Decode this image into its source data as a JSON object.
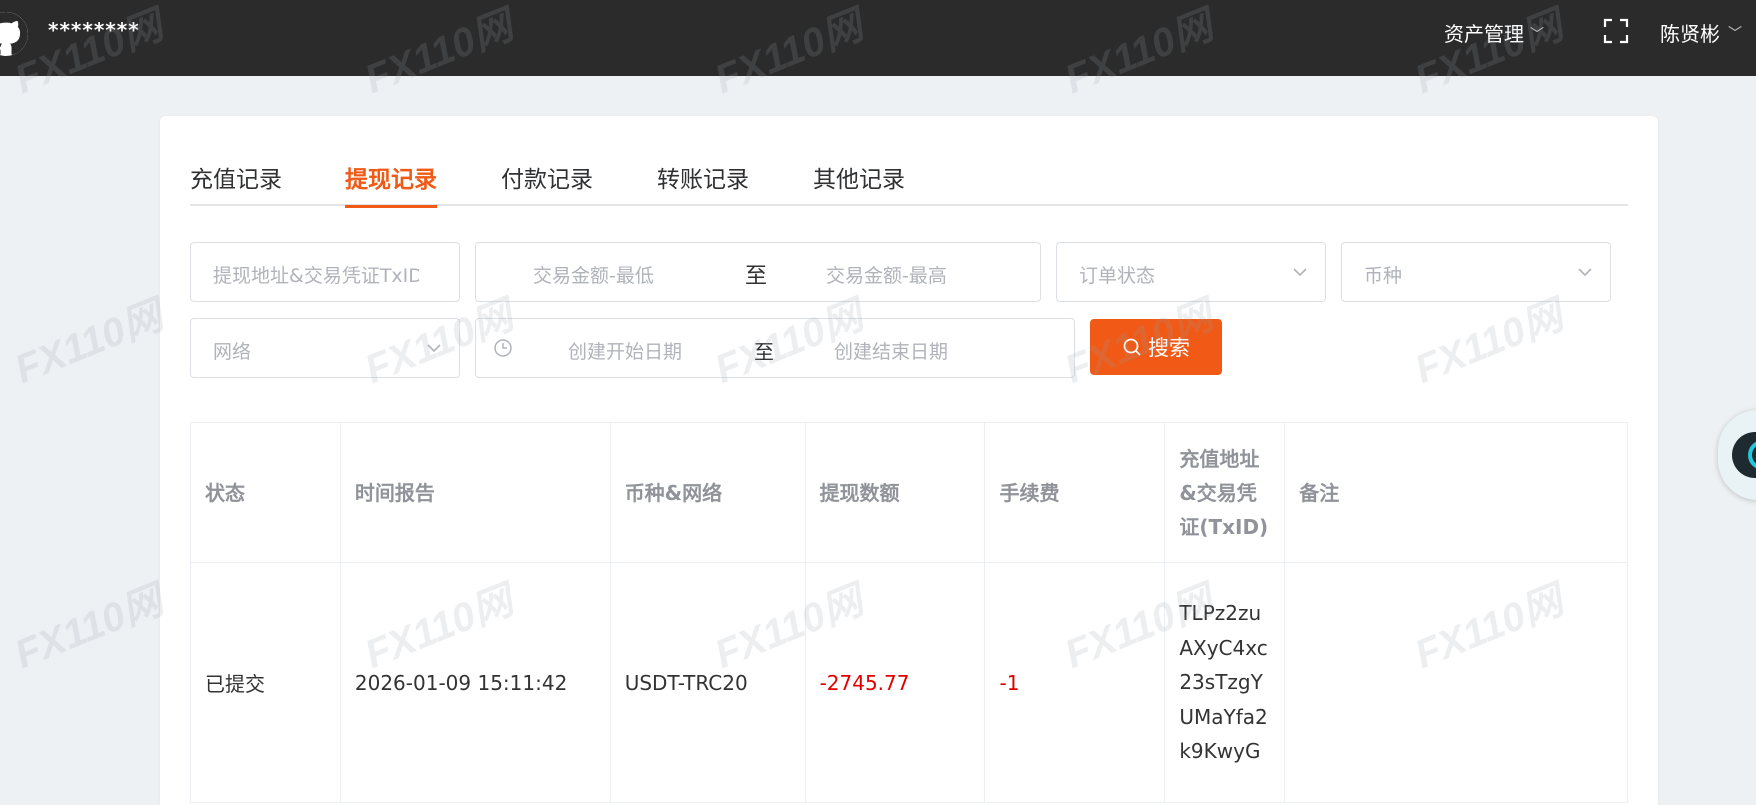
{
  "header": {
    "site_title": "********",
    "asset_menu_label": "资产管理",
    "user_name": "陈贤彬"
  },
  "tabs": [
    {
      "label": "充值记录",
      "active": false
    },
    {
      "label": "提现记录",
      "active": true
    },
    {
      "label": "付款记录",
      "active": false
    },
    {
      "label": "转账记录",
      "active": false
    },
    {
      "label": "其他记录",
      "active": false
    }
  ],
  "filters": {
    "address_placeholder": "提现地址&交易凭证TxID",
    "amount_min_placeholder": "交易金额-最低",
    "range_sep": "至",
    "amount_max_placeholder": "交易金额-最高",
    "status_placeholder": "订单状态",
    "currency_placeholder": "币种",
    "network_placeholder": "网络",
    "date_start_placeholder": "创建开始日期",
    "date_end_placeholder": "创建结束日期",
    "search_label": "搜索"
  },
  "table": {
    "columns": [
      "状态",
      "时间报告",
      "币种&网络",
      "提现数额",
      "手续费",
      "充值地址&交易凭证(TxID)",
      "备注"
    ],
    "rows": [
      {
        "status": "已提交",
        "time": "2026-01-09 15:11:42",
        "currency_network": "USDT-TRC20",
        "amount": "-2745.77",
        "fee": "-1",
        "txid": "TLPz2zuAXyC4xc23sTzgYUMaYfa2k9KwyG",
        "remark": ""
      }
    ]
  },
  "watermark_text": "FX110网",
  "colors": {
    "accent": "#f05a16",
    "negative": "#e10000",
    "topbar": "#2b2b2b"
  }
}
